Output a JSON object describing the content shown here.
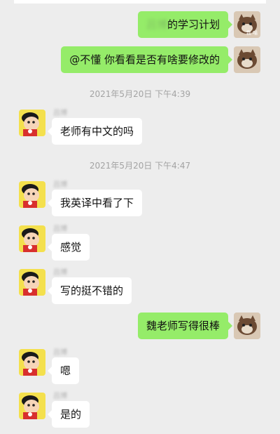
{
  "messages": [
    {
      "side": "out",
      "name_blurred": "吕博",
      "text": "的学习计划"
    },
    {
      "side": "out",
      "text": "@不懂 你看看是否有啥要修改的"
    },
    {
      "type": "time",
      "text": "2021年5月20日 下午4:39"
    },
    {
      "side": "in",
      "sender_blurred": "吕博",
      "text": "老师有中文的吗"
    },
    {
      "type": "time",
      "text": "2021年5月20日 下午4:47"
    },
    {
      "side": "in",
      "sender_blurred": "吕博",
      "text": "我英译中看了下"
    },
    {
      "side": "in",
      "sender_blurred": "吕博",
      "text": "感觉"
    },
    {
      "side": "in",
      "sender_blurred": "吕博",
      "text": "写的挺不错的"
    },
    {
      "side": "out",
      "text": "魏老师写得很棒"
    },
    {
      "side": "in",
      "sender_blurred": "吕博",
      "text": "嗯"
    },
    {
      "side": "in",
      "sender_blurred": "吕博",
      "text": "是的"
    }
  ],
  "avatars": {
    "self_icon": "cat-avatar",
    "self_caption": "我 喵",
    "other_icon": "cartoon-boy-avatar"
  },
  "colors": {
    "background": "#ededed",
    "outgoing_bubble": "#95ec69",
    "incoming_bubble": "#ffffff",
    "timestamp_text": "#a3a3a3"
  }
}
